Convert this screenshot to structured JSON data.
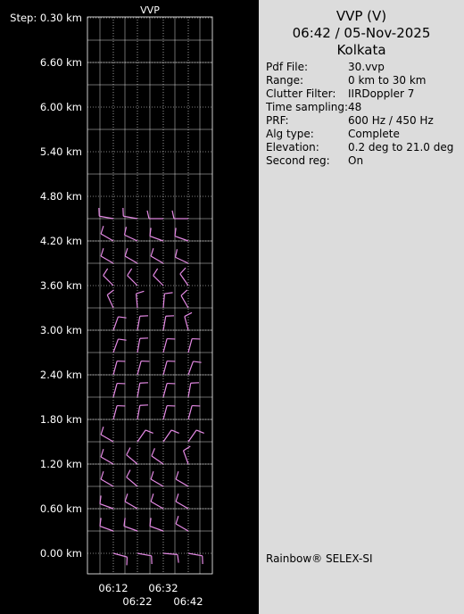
{
  "chart_data": {
    "type": "wind-barb profile",
    "title": "VVP",
    "y_unit": "km",
    "y_ticks": [
      "Step: 0.30 km",
      "6.60 km",
      "6.00 km",
      "5.40 km",
      "4.80 km",
      "4.20 km",
      "3.60 km",
      "3.00 km",
      "2.40 km",
      "1.80 km",
      "1.20 km",
      "0.60 km",
      "0.00 km"
    ],
    "y_tick_values": [
      null,
      6.6,
      6.0,
      5.4,
      4.8,
      4.2,
      3.6,
      3.0,
      2.4,
      1.8,
      1.2,
      0.6,
      0.0
    ],
    "x_ticks": [
      "06:12",
      "06:22",
      "06:32",
      "06:42"
    ],
    "ylim": [
      0,
      7.2
    ],
    "height_step_km": 0.3,
    "grid": true,
    "barb_color": "#e58ae5",
    "grid_color": "#ffffff",
    "heights_km": [
      0.0,
      0.3,
      0.6,
      0.9,
      1.2,
      1.5,
      1.8,
      2.1,
      2.4,
      2.7,
      3.0,
      3.3,
      3.6,
      3.9,
      4.2,
      4.5
    ],
    "barbs": [
      {
        "time": "06:12",
        "profiles": [
          [
            0.0,
            105,
            10
          ],
          [
            0.3,
            290,
            10
          ],
          [
            0.6,
            290,
            10
          ],
          [
            0.9,
            300,
            10
          ],
          [
            1.2,
            300,
            10
          ],
          [
            1.5,
            300,
            10
          ],
          [
            1.8,
            15,
            10
          ],
          [
            2.1,
            15,
            10
          ],
          [
            2.4,
            15,
            10
          ],
          [
            2.7,
            20,
            10
          ],
          [
            3.0,
            20,
            10
          ],
          [
            3.3,
            335,
            10
          ],
          [
            3.6,
            315,
            10
          ],
          [
            3.9,
            300,
            10
          ],
          [
            4.2,
            300,
            10
          ],
          [
            4.5,
            280,
            10
          ]
        ]
      },
      {
        "time": "06:22",
        "profiles": [
          [
            0.0,
            100,
            10
          ],
          [
            0.3,
            290,
            10
          ],
          [
            0.6,
            300,
            10
          ],
          [
            0.9,
            310,
            10
          ],
          [
            1.2,
            310,
            10
          ],
          [
            1.5,
            35,
            10
          ],
          [
            1.8,
            10,
            10
          ],
          [
            2.1,
            10,
            10
          ],
          [
            2.4,
            15,
            10
          ],
          [
            2.7,
            10,
            10
          ],
          [
            3.0,
            10,
            10
          ],
          [
            3.3,
            355,
            10
          ],
          [
            3.6,
            315,
            10
          ],
          [
            3.9,
            300,
            10
          ],
          [
            4.2,
            295,
            10
          ],
          [
            4.5,
            280,
            10
          ]
        ]
      },
      {
        "time": "06:32",
        "profiles": [
          [
            0.0,
            95,
            10
          ],
          [
            0.3,
            290,
            10
          ],
          [
            0.6,
            300,
            10
          ],
          [
            0.9,
            300,
            10
          ],
          [
            1.2,
            305,
            10
          ],
          [
            1.5,
            35,
            10
          ],
          [
            1.8,
            15,
            10
          ],
          [
            2.1,
            15,
            10
          ],
          [
            2.4,
            15,
            10
          ],
          [
            2.7,
            15,
            10
          ],
          [
            3.0,
            10,
            10
          ],
          [
            3.3,
            5,
            10
          ],
          [
            3.6,
            315,
            10
          ],
          [
            3.9,
            300,
            10
          ],
          [
            4.2,
            290,
            10
          ],
          [
            4.5,
            270,
            10
          ]
        ]
      },
      {
        "time": "06:42",
        "profiles": [
          [
            0.0,
            100,
            10
          ],
          [
            0.3,
            300,
            10
          ],
          [
            0.6,
            300,
            10
          ],
          [
            0.9,
            300,
            10
          ],
          [
            1.2,
            340,
            10
          ],
          [
            1.5,
            35,
            10
          ],
          [
            1.8,
            15,
            10
          ],
          [
            2.1,
            10,
            10
          ],
          [
            2.4,
            20,
            10
          ],
          [
            2.7,
            15,
            10
          ],
          [
            3.0,
            345,
            10
          ],
          [
            3.3,
            330,
            10
          ],
          [
            3.6,
            325,
            10
          ],
          [
            3.9,
            295,
            10
          ],
          [
            4.2,
            290,
            10
          ],
          [
            4.5,
            270,
            10
          ]
        ]
      }
    ]
  },
  "info": {
    "title": "VVP (V)",
    "datetime": "06:42 / 05-Nov-2025",
    "site": "Kolkata",
    "params": [
      {
        "key": "Pdf File:",
        "value": "30.vvp"
      },
      {
        "key": "Range:",
        "value": "0 km to 30 km"
      },
      {
        "key": "Clutter Filter:",
        "value": "IIRDoppler 7"
      },
      {
        "key": "Time sampling:",
        "value": "48"
      },
      {
        "key": "PRF:",
        "value": "600 Hz / 450 Hz"
      },
      {
        "key": "Alg type:",
        "value": "Complete"
      },
      {
        "key": "Elevation:",
        "value": "0.2 deg to 21.0 deg"
      },
      {
        "key": "Second reg:",
        "value": "On"
      }
    ],
    "brand": "Rainbow® SELEX-SI"
  }
}
